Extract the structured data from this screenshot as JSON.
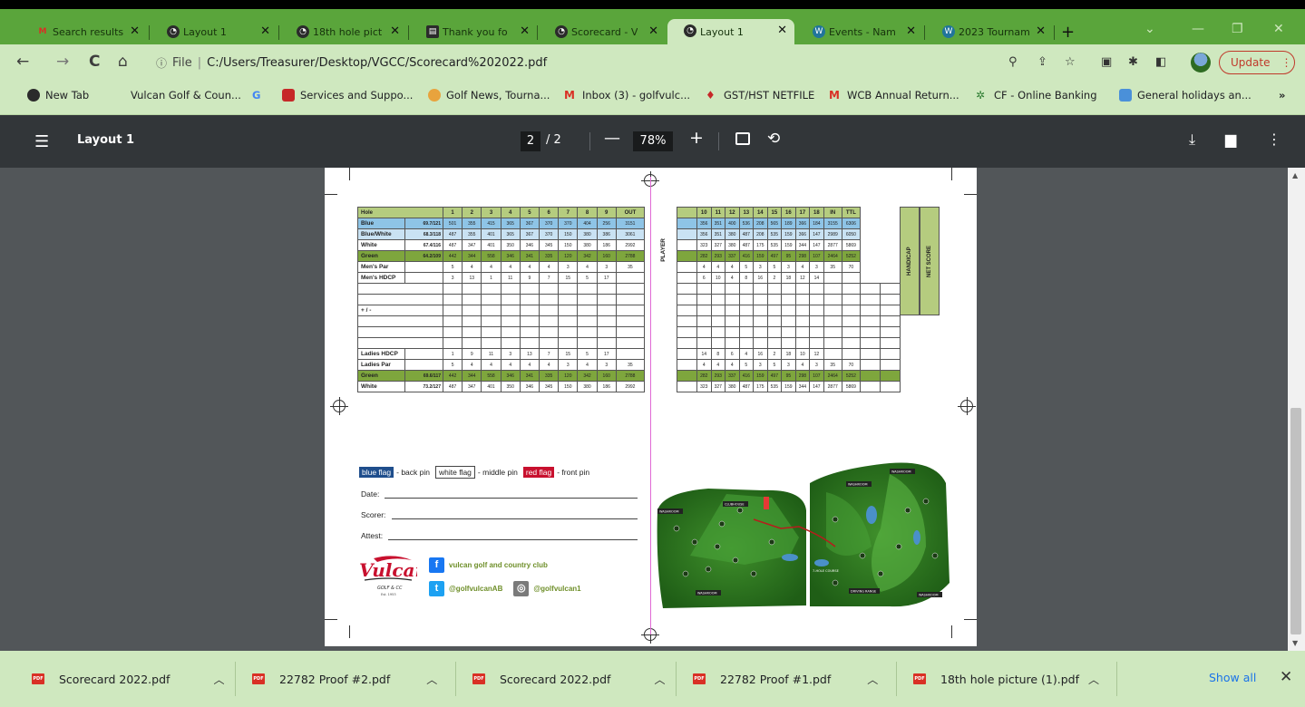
{
  "tabs": [
    {
      "title": "Search results",
      "icon": "gmail-icon",
      "active": false
    },
    {
      "title": "Layout 1",
      "icon": "chrome-icon",
      "active": false
    },
    {
      "title": "18th hole pict",
      "icon": "chrome-icon",
      "active": false
    },
    {
      "title": "Thank you fo",
      "icon": "document-icon",
      "active": false
    },
    {
      "title": "Scorecard - V",
      "icon": "chrome-icon",
      "active": false
    },
    {
      "title": "Layout 1",
      "icon": "chrome-icon",
      "active": true
    },
    {
      "title": "Events - Nam",
      "icon": "wordpress-icon",
      "active": false
    },
    {
      "title": "2023 Tournam",
      "icon": "wordpress-icon",
      "active": false
    }
  ],
  "address": {
    "scheme": "File",
    "url": "C:/Users/Treasurer/Desktop/VGCC/Scorecard%202022.pdf",
    "update_label": "Update"
  },
  "bookmarks": [
    {
      "label": "New Tab",
      "color": "#2b2b2b"
    },
    {
      "label": "Vulcan Golf & Coun...",
      "color": ""
    },
    {
      "label": "Services and Suppo...",
      "color": "#c62828"
    },
    {
      "label": "Golf News, Tourna...",
      "color": "#e8a33d"
    },
    {
      "label": "Inbox (3) - golfvulc...",
      "color": "#d93025"
    },
    {
      "label": "GST/HST NETFILE",
      "color": "#c62828"
    },
    {
      "label": "WCB Annual Return...",
      "color": "#d93025"
    },
    {
      "label": "CF - Online Banking",
      "color": "#2e7d32"
    },
    {
      "label": "General holidays an...",
      "color": "#4a90d9"
    }
  ],
  "google_glyph": "G",
  "pdf": {
    "title": "Layout 1",
    "page_current": "2",
    "page_total": "/ 2",
    "zoom": "78%"
  },
  "scorecard": {
    "header_label": "Hole",
    "front_holes": [
      "1",
      "2",
      "3",
      "4",
      "5",
      "6",
      "7",
      "8",
      "9",
      "OUT"
    ],
    "back_holes": [
      "10",
      "11",
      "12",
      "13",
      "14",
      "15",
      "16",
      "17",
      "18",
      "IN",
      "TTL"
    ],
    "player_label": "PLAYER",
    "handicap_label": "HANDICAP",
    "netscore_label": "NET SCORE",
    "top_rows": [
      {
        "label": "Blue",
        "rating": "69.7/121",
        "style": "blue",
        "front": [
          "501",
          "355",
          "415",
          "365",
          "367",
          "370",
          "370",
          "404",
          "256",
          "3151"
        ],
        "back": [
          "356",
          "351",
          "400",
          "536",
          "208",
          "565",
          "189",
          "366",
          "184",
          "3155",
          "6306"
        ]
      },
      {
        "label": "Blue/White",
        "rating": "68.3/118",
        "style": "bw",
        "front": [
          "487",
          "355",
          "401",
          "365",
          "367",
          "370",
          "150",
          "380",
          "386",
          "3061"
        ],
        "back": [
          "356",
          "351",
          "380",
          "487",
          "208",
          "535",
          "159",
          "366",
          "147",
          "2989",
          "6050"
        ]
      },
      {
        "label": "White",
        "rating": "67.4/116",
        "style": "white",
        "front": [
          "487",
          "347",
          "401",
          "350",
          "346",
          "345",
          "150",
          "380",
          "186",
          "2992"
        ],
        "back": [
          "323",
          "327",
          "380",
          "487",
          "175",
          "535",
          "159",
          "344",
          "147",
          "2877",
          "5869"
        ]
      },
      {
        "label": "Green",
        "rating": "64.2/109",
        "style": "green",
        "front": [
          "442",
          "344",
          "558",
          "346",
          "341",
          "335",
          "120",
          "342",
          "160",
          "2788"
        ],
        "back": [
          "282",
          "293",
          "337",
          "416",
          "159",
          "497",
          "95",
          "298",
          "107",
          "2464",
          "5252"
        ]
      },
      {
        "label": "Men's Par",
        "rating": "",
        "style": "plain",
        "front": [
          "5",
          "4",
          "4",
          "4",
          "4",
          "4",
          "3",
          "4",
          "3",
          "35"
        ],
        "back": [
          "4",
          "4",
          "4",
          "5",
          "3",
          "5",
          "3",
          "4",
          "3",
          "35",
          "70"
        ]
      },
      {
        "label": "Men's HDCP",
        "rating": "",
        "style": "plain",
        "front": [
          "3",
          "13",
          "1",
          "11",
          "9",
          "7",
          "15",
          "5",
          "17",
          ""
        ],
        "back": [
          "6",
          "10",
          "4",
          "8",
          "16",
          "2",
          "18",
          "12",
          "14",
          "",
          ""
        ]
      }
    ],
    "plusminus_label": "+ / -",
    "bottom_rows": [
      {
        "label": "Ladies HDCP",
        "rating": "",
        "style": "plain",
        "front": [
          "1",
          "9",
          "11",
          "3",
          "13",
          "7",
          "15",
          "5",
          "17",
          ""
        ],
        "back": [
          "14",
          "8",
          "6",
          "4",
          "16",
          "2",
          "18",
          "10",
          "12",
          "",
          ""
        ]
      },
      {
        "label": "Ladies Par",
        "rating": "",
        "style": "plain",
        "front": [
          "5",
          "4",
          "4",
          "4",
          "4",
          "4",
          "3",
          "4",
          "3",
          "35"
        ],
        "back": [
          "4",
          "4",
          "4",
          "5",
          "3",
          "5",
          "3",
          "4",
          "3",
          "35",
          "70"
        ]
      },
      {
        "label": "Green",
        "rating": "69.6/117",
        "style": "green",
        "front": [
          "442",
          "344",
          "558",
          "346",
          "341",
          "335",
          "120",
          "342",
          "160",
          "2788"
        ],
        "back": [
          "282",
          "293",
          "337",
          "416",
          "159",
          "497",
          "95",
          "298",
          "107",
          "2464",
          "5252"
        ]
      },
      {
        "label": "White",
        "rating": "73.2/127",
        "style": "white",
        "front": [
          "487",
          "347",
          "401",
          "350",
          "346",
          "345",
          "150",
          "380",
          "186",
          "2992"
        ],
        "back": [
          "323",
          "327",
          "380",
          "487",
          "175",
          "535",
          "159",
          "344",
          "147",
          "2877",
          "5869"
        ]
      }
    ],
    "legend": {
      "blue_flag": "blue flag",
      "blue_text": "- back pin",
      "white_flag": "white flag",
      "white_text": "- middle pin",
      "red_flag": "red flag",
      "red_text": "- front pin"
    },
    "date_label": "Date:",
    "scorer_label": "Scorer:",
    "attest_label": "Attest:",
    "logo_text": "Vulcan",
    "logo_sub": "GOLF & CC",
    "logo_est": "Est. 1953",
    "facebook": "vulcan golf and country club",
    "twitter": "@golfvulcanAB",
    "instagram": "@golfvulcan1",
    "map_labels": [
      "WASHROOM",
      "CLUBHOUSE",
      "WASHROOM",
      "WASHROOM",
      "WASHROOM",
      "7-HOLE COURSE",
      "DRIVING RANGE",
      "WASHROOM"
    ]
  },
  "downloads": [
    {
      "name": "Scorecard 2022.pdf"
    },
    {
      "name": "22782 Proof #2.pdf"
    },
    {
      "name": "Scorecard 2022.pdf"
    },
    {
      "name": "22782 Proof #1.pdf"
    },
    {
      "name": "18th hole picture (1).pdf"
    }
  ],
  "show_all_label": "Show all"
}
